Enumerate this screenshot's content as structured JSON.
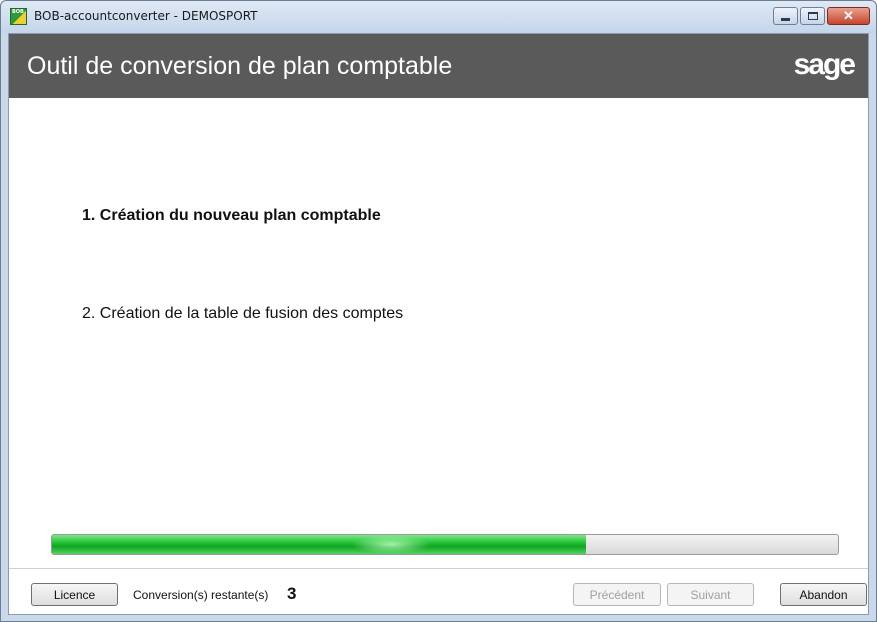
{
  "window": {
    "title": "BOB-accountconverter - DEMOSPORT",
    "app_icon_text": "BOB",
    "minimize_icon": "minimize-icon",
    "maximize_icon": "maximize-icon",
    "close_icon": "close-icon",
    "close_glyph": "✕"
  },
  "header": {
    "title": "Outil de conversion de plan comptable",
    "logo": "sage"
  },
  "steps": [
    {
      "label": "1. Création du nouveau plan comptable",
      "active": true
    },
    {
      "label": "2. Création de la table de fusion des comptes",
      "active": false
    }
  ],
  "progress": {
    "fraction": 0.68,
    "color": "#1fb82f"
  },
  "footer": {
    "licence_label": "Licence",
    "remaining_label": "Conversion(s) restante(s)",
    "remaining_count": "3",
    "previous_label": "Précédent",
    "next_label": "Suivant",
    "cancel_label": "Abandon"
  }
}
